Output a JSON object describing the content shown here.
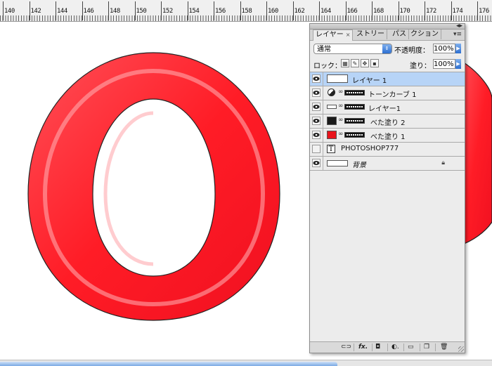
{
  "ruler": {
    "labels": [
      "140",
      "142",
      "144",
      "146",
      "148",
      "150",
      "152",
      "154",
      "156",
      "158",
      "160",
      "162",
      "164",
      "166",
      "168",
      "170",
      "172",
      "174",
      "176"
    ]
  },
  "panel": {
    "tabs": [
      {
        "label": "レイヤー",
        "close": "×"
      },
      {
        "label": "ストリー"
      },
      {
        "label": "パス"
      },
      {
        "label": "クション"
      }
    ],
    "blend_mode": "通常",
    "opacity_label": "不透明度：",
    "opacity_value": "100%",
    "lock_label": "ロック：",
    "fill_label": "塗り：",
    "fill_value": "100%",
    "layers": [
      {
        "name": "レイヤー 1",
        "visible": true,
        "selected": true
      },
      {
        "name": "トーンカーブ 1",
        "visible": true
      },
      {
        "name": "レイヤー1",
        "visible": true
      },
      {
        "name": "べた塗り 2",
        "visible": true,
        "color": "#1a1a1a"
      },
      {
        "name": "べた塗り 1",
        "visible": true,
        "color": "#e8141c"
      },
      {
        "name": "PHOTOSHOP777",
        "visible": false,
        "type_icon": "T"
      },
      {
        "name": "背景",
        "visible": true,
        "locked": true
      }
    ],
    "bottom_icons": [
      "link-icon",
      "fx-icon",
      "mask-icon",
      "adjustment-icon",
      "group-folder-icon",
      "new-layer-icon",
      "trash-icon"
    ]
  },
  "colors": {
    "letter_red": "#ff2430",
    "selection_blue": "#b7d4f7",
    "accent_blue": "#2c6fd1"
  }
}
